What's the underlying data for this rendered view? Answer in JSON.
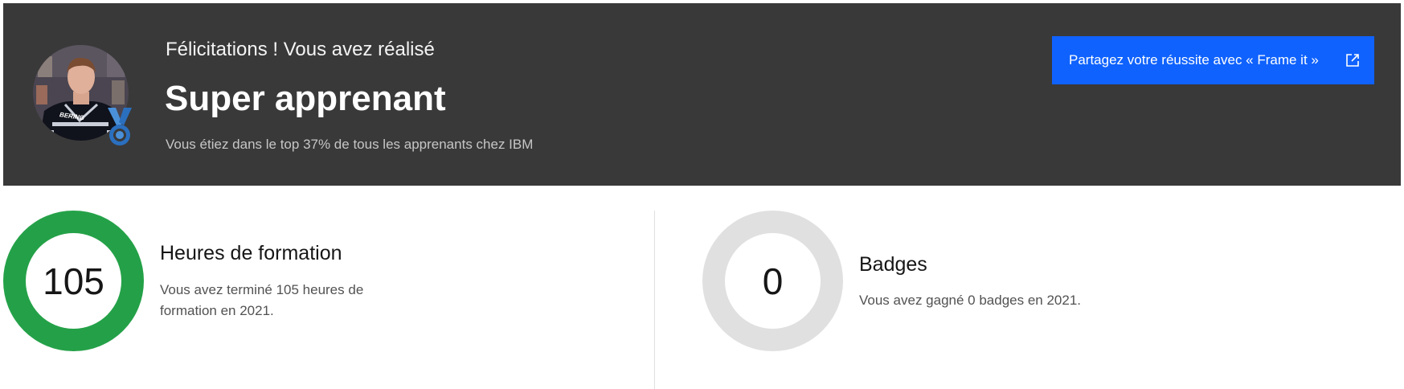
{
  "hero": {
    "congrats": "Félicitations ! Vous avez réalisé",
    "title": "Super apprenant",
    "subtitle": "Vous étiez dans le top 37% de tous les apprenants chez IBM",
    "share_button": "Partagez votre réussite avec « Frame it »",
    "share_icon": "external-link-icon",
    "badge_icon": "medal-icon",
    "jersey_text": "BERING",
    "background_color": "#393939",
    "button_color": "#0f62fe"
  },
  "stats": {
    "hours": {
      "value": "105",
      "title": "Heures de formation",
      "description": "Vous avez terminé 105 heures de formation en 2021.",
      "ring_color": "#24a148",
      "progress": 1.0
    },
    "badges": {
      "value": "0",
      "title": "Badges",
      "description": "Vous avez gagné 0 badges en 2021.",
      "ring_color": "#e0e0e0",
      "progress": 0.0
    }
  }
}
